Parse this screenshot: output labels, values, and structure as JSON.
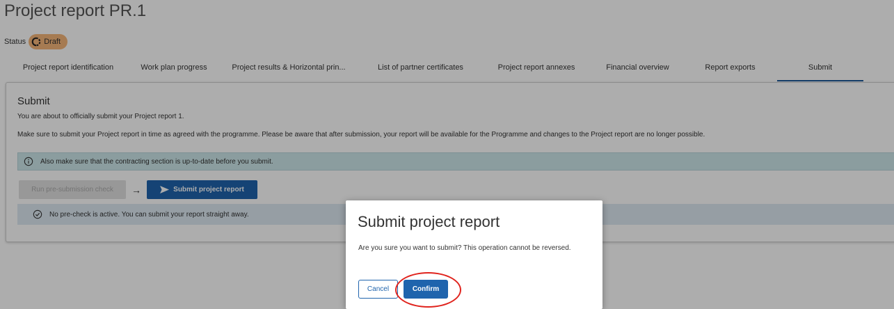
{
  "header": {
    "title": "Project report PR.1",
    "status_label": "Status",
    "status_badge": "Draft"
  },
  "tabs": [
    {
      "label": "Project report identification",
      "active": false
    },
    {
      "label": "Work plan progress",
      "active": false
    },
    {
      "label": "Project results & Horizontal prin...",
      "active": false
    },
    {
      "label": "List of partner certificates",
      "active": false
    },
    {
      "label": "Project report annexes",
      "active": false
    },
    {
      "label": "Financial overview",
      "active": false
    },
    {
      "label": "Report exports",
      "active": false
    },
    {
      "label": "Submit",
      "active": true
    }
  ],
  "submit_section": {
    "heading": "Submit",
    "intro": "You are about to officially submit your Project report 1.",
    "notice": "Make sure to submit your Project report in time as agreed with the programme. Please be aware that after submission, your report will be available for the Programme and changes to the Project report are no longer possible.",
    "alert": "Also make sure that the contracting section is up-to-date before you submit.",
    "precheck_button": "Run pre-submission check",
    "arrow": "→",
    "submit_button": "Submit project report",
    "precheck_info": "No pre-check is active. You can submit your report straight away."
  },
  "dialog": {
    "title": "Submit project report",
    "message": "Are you sure you want to submit? This operation cannot be reversed.",
    "cancel": "Cancel",
    "confirm": "Confirm"
  },
  "colors": {
    "primary": "#1f64ad",
    "draft_badge": "#f5b57a",
    "alert_bg": "#cde7ea",
    "highlight": "#e0231d"
  }
}
